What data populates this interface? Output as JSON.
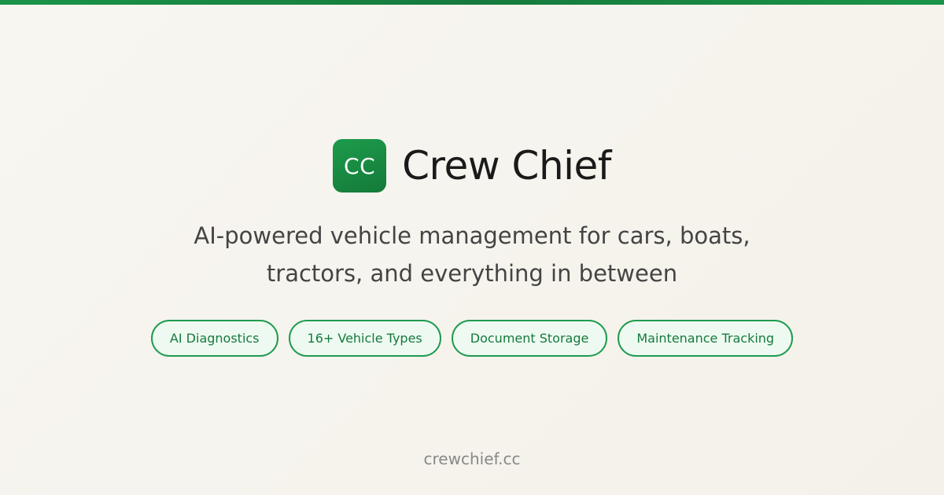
{
  "brand": {
    "logo_text": "CC",
    "name": "Crew Chief"
  },
  "tagline": {
    "line1": "AI-powered vehicle management for cars, boats,",
    "line2": "tractors, and everything in between"
  },
  "features": [
    {
      "label": "AI Diagnostics"
    },
    {
      "label": "16+ Vehicle Types"
    },
    {
      "label": "Document Storage"
    },
    {
      "label": "Maintenance Tracking"
    }
  ],
  "footer": {
    "url": "crewchief.cc"
  },
  "colors": {
    "accent": "#1a9448",
    "pill_background": "#eefaf1",
    "text_primary": "#1a1a1a",
    "text_secondary": "#444444"
  }
}
